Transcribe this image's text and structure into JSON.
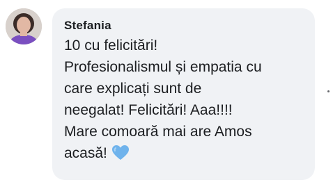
{
  "comment": {
    "author": "Stefania",
    "lines": [
      "10 cu felicitări!",
      "Profesionalismul și empatia cu",
      "care explicați sunt de",
      "neegalat! Felicitări! Aaa!!!!",
      "Mare comoară mai are Amos",
      "acasă!"
    ],
    "emoji": "blue-heart-icon"
  },
  "colors": {
    "bubble_bg": "#f0f2f5",
    "text": "#1c1e21",
    "heart": "#6fb3ec"
  }
}
